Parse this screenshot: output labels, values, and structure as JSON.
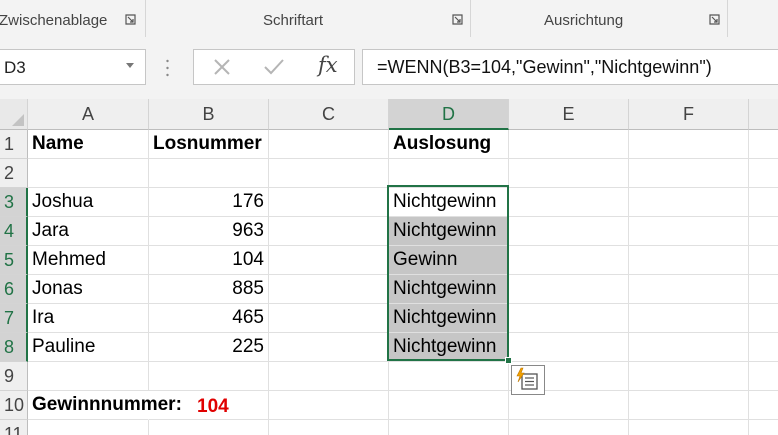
{
  "ribbon": {
    "groups": [
      {
        "label": "Zwischenablage",
        "launcher_icon": "dialog-launcher-icon"
      },
      {
        "label": "Schriftart",
        "launcher_icon": "dialog-launcher-icon"
      },
      {
        "label": "Ausrichtung",
        "launcher_icon": "dialog-launcher-icon"
      }
    ]
  },
  "formula_bar": {
    "name_box": "D3",
    "cancel_icon": "cancel-x-icon",
    "enter_icon": "checkmark-icon",
    "function_label": "fx",
    "formula": "=WENN(B3=104,\"Gewinn\",\"Nichtgewinn\")"
  },
  "sheet": {
    "columns": [
      "A",
      "B",
      "C",
      "D",
      "E",
      "F"
    ],
    "rows": [
      "1",
      "2",
      "3",
      "4",
      "5",
      "6",
      "7",
      "8",
      "9",
      "10",
      "11"
    ],
    "selected_column": "D",
    "selected_rows": [
      "3",
      "4",
      "5",
      "6",
      "7",
      "8"
    ],
    "headers": {
      "name": "Name",
      "losnummer": "Losnummer",
      "auslosung": "Auslosung"
    },
    "data": [
      {
        "name": "Joshua",
        "losnummer": "176",
        "auslosung": "Nichtgewinn"
      },
      {
        "name": "Jara",
        "losnummer": "963",
        "auslosung": "Nichtgewinn"
      },
      {
        "name": "Mehmed",
        "losnummer": "104",
        "auslosung": "Gewinn"
      },
      {
        "name": "Jonas",
        "losnummer": "885",
        "auslosung": "Nichtgewinn"
      },
      {
        "name": "Ira",
        "losnummer": "465",
        "auslosung": "Nichtgewinn"
      },
      {
        "name": "Pauline",
        "losnummer": "225",
        "auslosung": "Nichtgewinn"
      }
    ],
    "winning_label": "Gewinnnummer:",
    "winning_number": "104",
    "flash_fill_icon": "flash-fill-options-icon"
  },
  "colors": {
    "accent": "#217346",
    "highlight": "#e00000",
    "selection_shade": "#c6c6c6"
  }
}
